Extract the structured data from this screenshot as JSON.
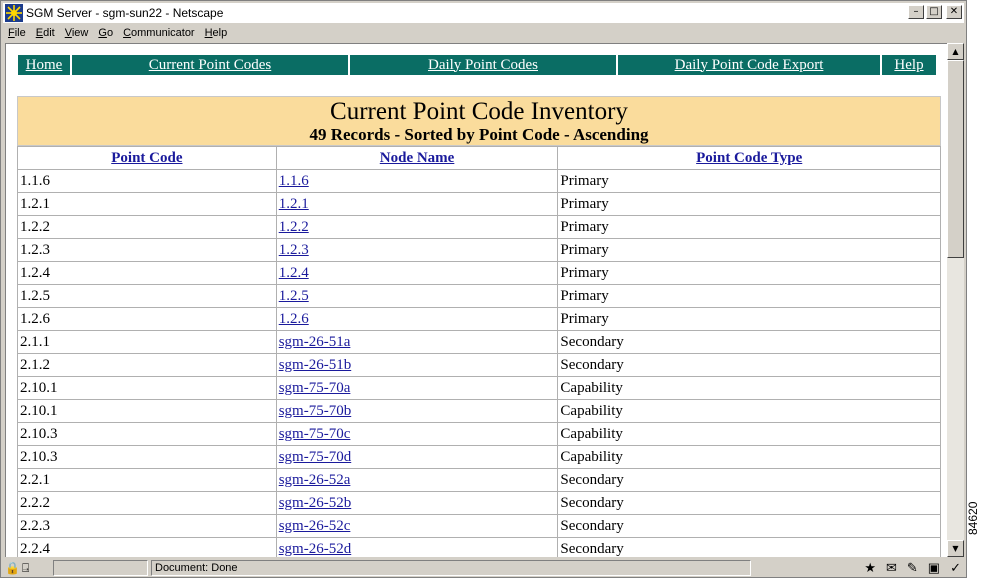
{
  "window": {
    "title": "SGM Server - sgm-sun22 - Netscape"
  },
  "menu": [
    "File",
    "Edit",
    "View",
    "Go",
    "Communicator",
    "Help"
  ],
  "nav": [
    {
      "label": "Home"
    },
    {
      "label": "Current Point Codes"
    },
    {
      "label": "Daily Point Codes"
    },
    {
      "label": "Daily Point Code Export"
    },
    {
      "label": "Help"
    }
  ],
  "header": {
    "title": "Current Point Code Inventory",
    "subtitle": "49 Records - Sorted by Point Code - Ascending"
  },
  "table": {
    "columns": [
      "Point Code",
      "Node Name",
      "Point Code Type"
    ],
    "rows": [
      [
        "1.1.6",
        "1.1.6",
        "Primary"
      ],
      [
        "1.2.1",
        "1.2.1",
        "Primary"
      ],
      [
        "1.2.2",
        "1.2.2",
        "Primary"
      ],
      [
        "1.2.3",
        "1.2.3",
        "Primary"
      ],
      [
        "1.2.4",
        "1.2.4",
        "Primary"
      ],
      [
        "1.2.5",
        "1.2.5",
        "Primary"
      ],
      [
        "1.2.6",
        "1.2.6",
        "Primary"
      ],
      [
        "2.1.1",
        "sgm-26-51a",
        "Secondary"
      ],
      [
        "2.1.2",
        "sgm-26-51b",
        "Secondary"
      ],
      [
        "2.10.1",
        "sgm-75-70a",
        "Capability"
      ],
      [
        "2.10.1",
        "sgm-75-70b",
        "Capability"
      ],
      [
        "2.10.3",
        "sgm-75-70c",
        "Capability"
      ],
      [
        "2.10.3",
        "sgm-75-70d",
        "Capability"
      ],
      [
        "2.2.1",
        "sgm-26-52a",
        "Secondary"
      ],
      [
        "2.2.2",
        "sgm-26-52b",
        "Secondary"
      ],
      [
        "2.2.3",
        "sgm-26-52c",
        "Secondary"
      ],
      [
        "2.2.4",
        "sgm-26-52d",
        "Secondary"
      ]
    ]
  },
  "status": {
    "text": "Document: Done"
  },
  "figure_id": "84620",
  "colors": {
    "nav_bg": "#0a6d64",
    "header_bg": "#fadc9c",
    "link": "#1a1a9c"
  }
}
